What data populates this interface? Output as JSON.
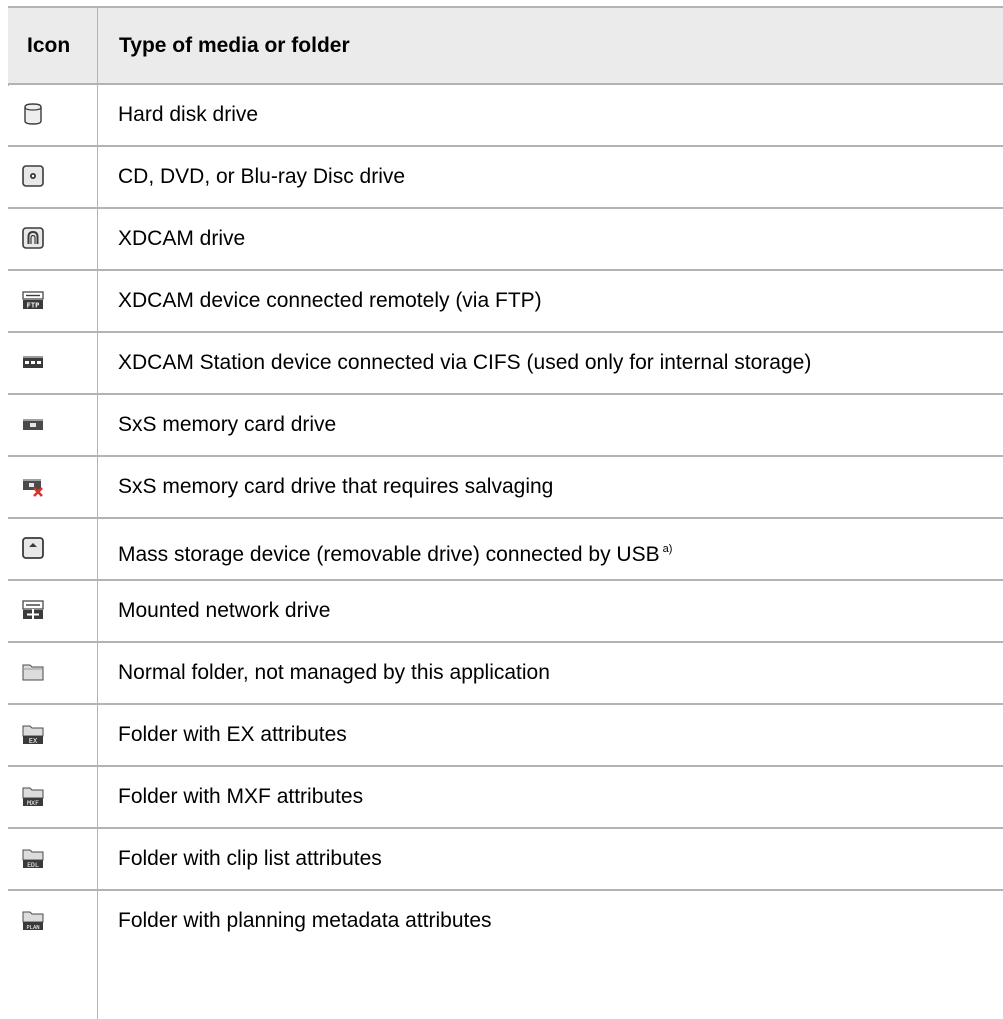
{
  "table": {
    "headers": {
      "icon": "Icon",
      "type": "Type of media or folder"
    },
    "rows": [
      {
        "icon": "hard-disk-drive-icon",
        "label": "Hard disk drive"
      },
      {
        "icon": "optical-disc-drive-icon",
        "label": "CD, DVD, or Blu-ray Disc drive"
      },
      {
        "icon": "xdcam-drive-icon",
        "label": "XDCAM drive"
      },
      {
        "icon": "ftp-device-icon",
        "label": "XDCAM device connected remotely (via FTP)"
      },
      {
        "icon": "cifs-station-icon",
        "label": "XDCAM Station device connected via CIFS (used only for internal storage)"
      },
      {
        "icon": "sxs-card-icon",
        "label": "SxS memory card drive"
      },
      {
        "icon": "sxs-card-salvage-icon",
        "label": "SxS memory card drive that requires salvaging"
      },
      {
        "icon": "usb-mass-storage-icon",
        "label": "Mass storage device (removable drive) connected by USB",
        "footnote": "a)"
      },
      {
        "icon": "network-drive-icon",
        "label": "Mounted network drive"
      },
      {
        "icon": "folder-icon",
        "label": "Normal folder, not managed by this application"
      },
      {
        "icon": "folder-ex-icon",
        "label": "Folder with EX attributes",
        "icon_text": "EX"
      },
      {
        "icon": "folder-mxf-icon",
        "label": "Folder with MXF attributes",
        "icon_text": "MXF"
      },
      {
        "icon": "folder-edl-icon",
        "label": "Folder with clip list attributes",
        "icon_text": "EDL"
      },
      {
        "icon": "folder-plan-icon",
        "label": "Folder with planning metadata attributes",
        "icon_text": "PLAN"
      }
    ]
  },
  "colors": {
    "header_background": "#ebebeb",
    "grid_line": "#b3b3b3",
    "text": "#000000"
  }
}
